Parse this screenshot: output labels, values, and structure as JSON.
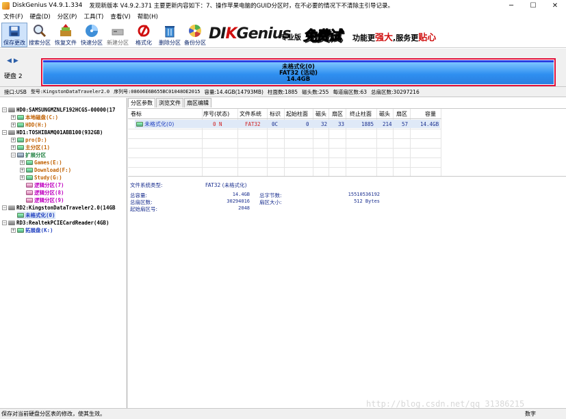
{
  "titlebar": {
    "title": "DiskGenius V4.9.1.334",
    "update_notice": "发现新版本 V4.9.2.371 主要更新内容如下：7、操作苹果电脑的GUID分区时，在不必要的情况下不清除主引导记录。",
    "minimize": "─",
    "maximize": "☐",
    "close": "✕"
  },
  "menu": [
    "文件(F)",
    "硬盘(D)",
    "分区(P)",
    "工具(T)",
    "查看(V)",
    "帮助(H)"
  ],
  "toolbar": {
    "save": "保存更改",
    "search": "搜索分区",
    "recover": "恢复文件",
    "quick": "快速分区",
    "new": "新建分区",
    "format": "格式化",
    "delete": "删除分区",
    "backup": "备份分区"
  },
  "banner": {
    "brand_left": "DI",
    "brand_k": "K",
    "brand_right": "Genius",
    "edition": "专业版",
    "free": "免费试用",
    "slogan_a": "功能更",
    "slogan_b": "强大",
    "slogan_c": ",服务更",
    "slogan_d": "贴心"
  },
  "diskbar": {
    "label": "硬盘 2",
    "part_name": "未格式化(0)",
    "part_fs": "FAT32 (活动)",
    "part_size": "14.4GB"
  },
  "info": {
    "iface": "接口:USB",
    "model": "型号:KingstonDataTraveler2.0",
    "serial": "序列号:08606E6B655BC01048OE2015",
    "capacity": "容量:14.4GB(14793MB)",
    "cylinders": "柱面数:1885",
    "heads": "磁头数:255",
    "spt": "每道扇区数:63",
    "sectors": "总扇区数:30297216"
  },
  "tree": [
    {
      "text": "HD0:SAMSUNGMZNLF192HCGS-00000(17",
      "color": "t-black",
      "icon": "ic-disk",
      "exp": "−"
    },
    {
      "text": "本地磁盘(C:)",
      "color": "t-orange",
      "icon": "ic-part",
      "exp": "+"
    },
    {
      "text": "HDD(H:)",
      "color": "t-orange",
      "icon": "ic-part",
      "exp": "+"
    },
    {
      "text": "HD1:TOSHIBAMQ01ABB100(932GB)",
      "color": "t-black",
      "icon": "ic-disk",
      "exp": "−"
    },
    {
      "text": "pro(D:)",
      "color": "t-orange",
      "icon": "ic-part",
      "exp": "+"
    },
    {
      "text": "主分区(1)",
      "color": "t-orange",
      "icon": "ic-part",
      "exp": "+"
    },
    {
      "text": "扩展分区",
      "color": "t-green",
      "icon": "ic-ext",
      "exp": "−"
    },
    {
      "text": "Games(E:)",
      "color": "t-orange",
      "icon": "ic-part",
      "exp": "+"
    },
    {
      "text": "Download(F:)",
      "color": "t-orange",
      "icon": "ic-part",
      "exp": "+"
    },
    {
      "text": "Study(G:)",
      "color": "t-orange",
      "icon": "ic-part",
      "exp": "+"
    },
    {
      "text": "逻辑分区(7)",
      "color": "t-magenta",
      "icon": "ic-logic",
      "exp": ""
    },
    {
      "text": "逻辑分区(8)",
      "color": "t-magenta",
      "icon": "ic-logic",
      "exp": ""
    },
    {
      "text": "逻辑分区(9)",
      "color": "t-magenta",
      "icon": "ic-logic",
      "exp": ""
    },
    {
      "text": "RD2:KingstonDataTraveler2.0(14GB",
      "color": "t-black",
      "icon": "ic-disk",
      "exp": "−"
    },
    {
      "text": "未格式化(0)",
      "color": "t-blue",
      "icon": "ic-part",
      "exp": ""
    },
    {
      "text": "RD3:RealtekPCIECardReader(4GB)",
      "color": "t-black",
      "icon": "ic-disk",
      "exp": "−"
    },
    {
      "text": "拓展盘(K:)",
      "color": "t-blue",
      "icon": "ic-part",
      "exp": "+"
    }
  ],
  "tabs": [
    "分区参数",
    "浏览文件",
    "扇区编辑"
  ],
  "table": {
    "headers": [
      "卷标",
      "序号(状态)",
      "文件系统",
      "标识",
      "起始柱面",
      "磁头",
      "扇区",
      "终止柱面",
      "磁头",
      "扇区",
      "容量"
    ],
    "row": [
      "未格式化(0)",
      "0 N",
      "FAT32",
      "0C",
      "0",
      "32",
      "33",
      "1885",
      "214",
      "57",
      "14.4GB"
    ]
  },
  "detail": {
    "fs_type_label": "文件系统类型:",
    "fs_type_value": "FAT32 (未格式化)",
    "total_cap_label": "总容量:",
    "total_cap_value": "14.4GB",
    "total_bytes_label": "总字节数:",
    "total_bytes_value": "15510536192",
    "total_sectors_label": "总扇区数:",
    "total_sectors_value": "30294016",
    "sector_size_label": "扇区大小:",
    "sector_size_value": "512 Bytes",
    "start_sector_label": "起始扇区号:",
    "start_sector_value": "2048"
  },
  "watermark": "http://blog.csdn.net/qq_31386215",
  "status": {
    "text": "保存对当前硬盘分区表的修改，使其生效。",
    "right": "数字"
  }
}
